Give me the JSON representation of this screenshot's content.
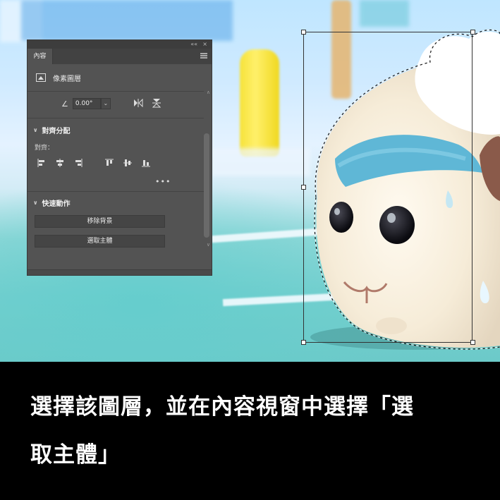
{
  "panel": {
    "tab_label": "內容",
    "layer_type": "像素圖層",
    "angle": {
      "value": "0.00°"
    },
    "align_section": {
      "title": "對齊分配",
      "label": "對齊："
    },
    "quick_actions": {
      "title": "快速動作",
      "remove_bg_label": "移除背景",
      "select_subject_label": "選取主體"
    },
    "more_label": "•••",
    "collapse_label": "««",
    "close_label": "×"
  },
  "caption": {
    "line1": "選擇該圖層，並在內容視窗中選擇「選",
    "line2": "取主體」"
  },
  "colors": {
    "panel_bg": "#535353",
    "caption_bg": "#000000",
    "caption_text": "#ffffff"
  },
  "icons": [
    "layer-icon",
    "angle-icon",
    "flip-horizontal-icon",
    "flip-vertical-icon",
    "align-left-icon",
    "align-center-h-icon",
    "align-right-icon",
    "align-top-icon",
    "align-middle-v-icon",
    "align-bottom-icon",
    "chevron-down-icon"
  ]
}
